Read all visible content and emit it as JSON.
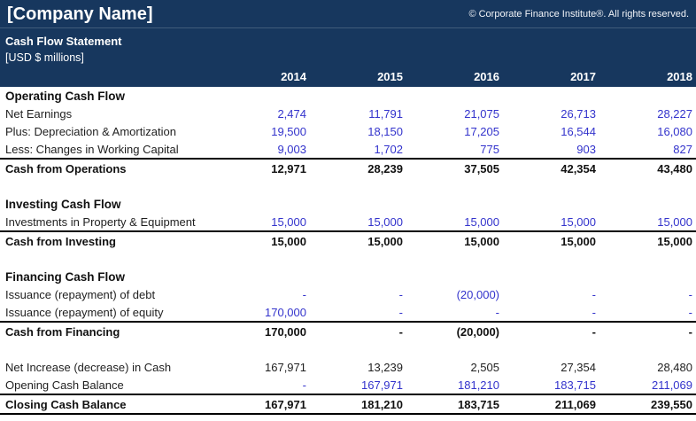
{
  "header": {
    "company_name": "[Company Name]",
    "copyright": "© Corporate Finance Institute®. All rights reserved.",
    "title": "Cash Flow Statement",
    "units": "[USD $ millions]",
    "years": [
      "2014",
      "2015",
      "2016",
      "2017",
      "2018"
    ]
  },
  "colors": {
    "header_bg": "#17375E",
    "input_blue": "#3333CC",
    "total_border": "#000000"
  },
  "table": {
    "rows": [
      {
        "label": "Operating Cash Flow",
        "type": "section",
        "values": [
          "",
          "",
          "",
          "",
          ""
        ]
      },
      {
        "label": "Net Earnings",
        "type": "input",
        "values": [
          "2,474",
          "11,791",
          "21,075",
          "26,713",
          "28,227"
        ]
      },
      {
        "label": "Plus: Depreciation & Amortization",
        "type": "input",
        "values": [
          "19,500",
          "18,150",
          "17,205",
          "16,544",
          "16,080"
        ]
      },
      {
        "label": "Less: Changes in Working Capital",
        "type": "input",
        "values": [
          "9,003",
          "1,702",
          "775",
          "903",
          "827"
        ]
      },
      {
        "label": "Cash from Operations",
        "type": "total",
        "values": [
          "12,971",
          "28,239",
          "37,505",
          "42,354",
          "43,480"
        ]
      },
      {
        "label": "",
        "type": "blank",
        "values": [
          "",
          "",
          "",
          "",
          ""
        ]
      },
      {
        "label": "Investing Cash Flow",
        "type": "section",
        "values": [
          "",
          "",
          "",
          "",
          ""
        ]
      },
      {
        "label": "Investments in Property & Equipment",
        "type": "input",
        "values": [
          "15,000",
          "15,000",
          "15,000",
          "15,000",
          "15,000"
        ]
      },
      {
        "label": "Cash from Investing",
        "type": "total",
        "values": [
          "15,000",
          "15,000",
          "15,000",
          "15,000",
          "15,000"
        ]
      },
      {
        "label": "",
        "type": "blank",
        "values": [
          "",
          "",
          "",
          "",
          ""
        ]
      },
      {
        "label": "Financing Cash Flow",
        "type": "section",
        "values": [
          "",
          "",
          "",
          "",
          ""
        ]
      },
      {
        "label": "Issuance (repayment) of debt",
        "type": "input",
        "values": [
          "-",
          "-",
          "(20,000)",
          "-",
          "-"
        ]
      },
      {
        "label": "Issuance (repayment) of equity",
        "type": "input",
        "values": [
          "170,000",
          "-",
          "-",
          "-",
          "-"
        ]
      },
      {
        "label": "Cash from Financing",
        "type": "total",
        "values": [
          "170,000",
          "-",
          "(20,000)",
          "-",
          "-"
        ]
      },
      {
        "label": "",
        "type": "blank",
        "values": [
          "",
          "",
          "",
          "",
          ""
        ]
      },
      {
        "label": "Net Increase (decrease) in Cash",
        "type": "calc",
        "values": [
          "167,971",
          "13,239",
          "2,505",
          "27,354",
          "28,480"
        ]
      },
      {
        "label": "Opening Cash Balance",
        "type": "input",
        "values": [
          "-",
          "167,971",
          "181,210",
          "183,715",
          "211,069"
        ]
      },
      {
        "label": "Closing Cash Balance",
        "type": "grand",
        "values": [
          "167,971",
          "181,210",
          "183,715",
          "211,069",
          "239,550"
        ]
      }
    ]
  }
}
